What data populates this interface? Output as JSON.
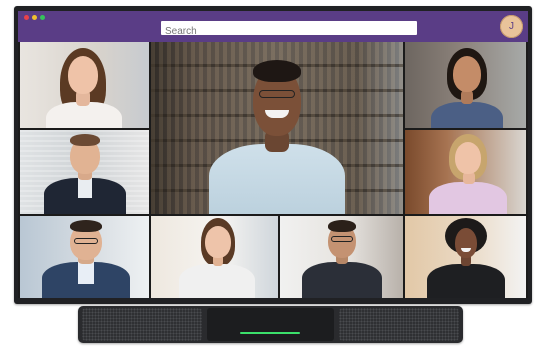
{
  "window": {
    "search": {
      "placeholder": "Search"
    },
    "user_avatar_initial": "J",
    "title_bar_color": "#5a3d86"
  },
  "participants": [
    {
      "id": "p1",
      "position": "top-left"
    },
    {
      "id": "p2",
      "position": "center-large"
    },
    {
      "id": "p3",
      "position": "top-right"
    },
    {
      "id": "p4",
      "position": "middle-left"
    },
    {
      "id": "p5",
      "position": "middle-right"
    },
    {
      "id": "p6",
      "position": "bottom-1"
    },
    {
      "id": "p7",
      "position": "bottom-2"
    },
    {
      "id": "p8",
      "position": "bottom-3"
    },
    {
      "id": "p9",
      "position": "bottom-4"
    }
  ],
  "device": {
    "soundbar_indicator_color": "#3be06b"
  }
}
